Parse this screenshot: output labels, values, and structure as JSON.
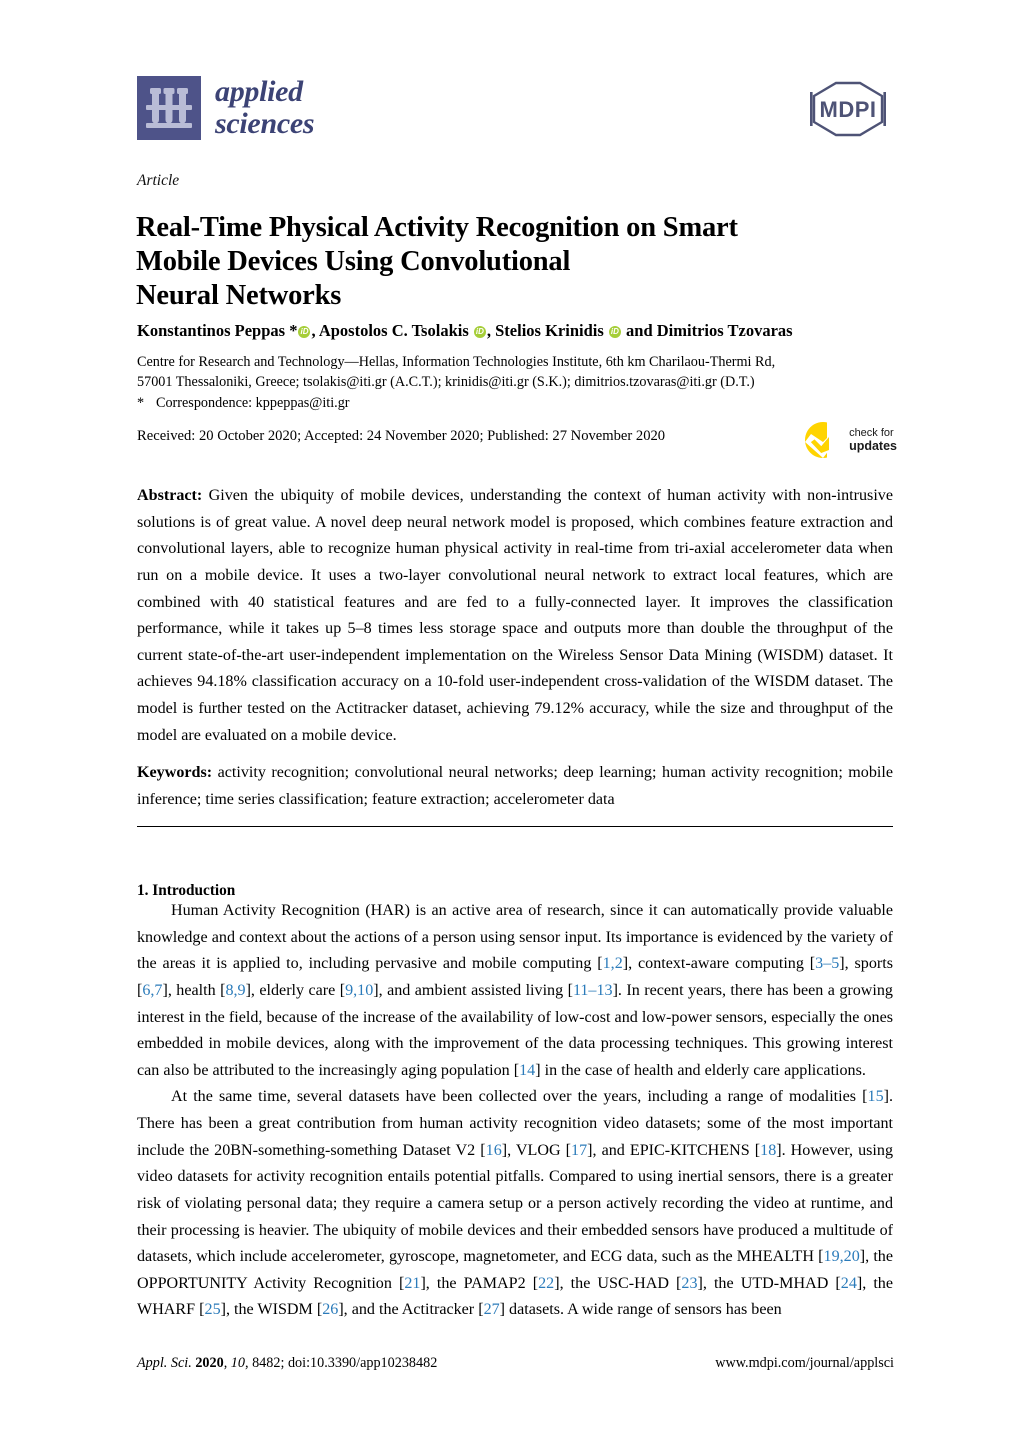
{
  "journal": {
    "name_line1": "applied",
    "name_line2": "sciences",
    "logo_icon": "test-tube-rack-icon",
    "publisher_logo_text": "MDPI"
  },
  "article": {
    "type": "Article",
    "title_line1": "Real-Time Physical Activity Recognition on Smart",
    "title_line2": "Mobile Devices Using Convolutional",
    "title_line3": "Neural Networks"
  },
  "authors": {
    "a1": "Konstantinos Peppas *",
    "orcid_glyph": "iD",
    "sep1": ", ",
    "a2": "Apostolos C. Tsolakis ",
    "sep2": ", ",
    "a3": "Stelios Krinidis ",
    "sep3": " and ",
    "a4": "Dimitrios Tzovaras"
  },
  "affiliation": {
    "line1": "Centre for Research and Technology—Hellas, Information Technologies Institute, 6th km Charilaou-Thermi Rd,",
    "line2": "57001 Thessaloniki, Greece; tsolakis@iti.gr (A.C.T.); krinidis@iti.gr (S.K.); dimitrios.tzovaras@iti.gr (D.T.)",
    "corr_marker": "*",
    "corr_text": "Correspondence: kppeppas@iti.gr"
  },
  "dates": {
    "text": "Received: 20 October 2020; Accepted: 24 November 2020; Published: 27 November 2020"
  },
  "check_for_updates": {
    "line1": "check for",
    "line2": "updates",
    "icon": "yellow-checkmark-icon",
    "color": "#ffd400"
  },
  "abstract": {
    "label": "Abstract:",
    "body": " Given the ubiquity of mobile devices, understanding the context of human activity with non-intrusive solutions is of great value. A novel deep neural network model is proposed, which combines feature extraction and convolutional layers, able to recognize human physical activity in real-time from tri-axial accelerometer data when run on a mobile device. It uses a two-layer convolutional neural network to extract local features, which are combined with 40 statistical features and are fed to a fully-connected layer. It improves the classification performance, while it takes up 5–8 times less storage space and outputs more than double the throughput of the current state-of-the-art user-independent implementation on the Wireless Sensor Data Mining (WISDM) dataset. It achieves 94.18% classification accuracy on a 10-fold user-independent cross-validation of the WISDM dataset. The model is further tested on the Actitracker dataset, achieving 79.12% accuracy, while the size and throughput of the model are evaluated on a mobile device."
  },
  "keywords": {
    "label": "Keywords:",
    "body": " activity recognition; convolutional neural networks; deep learning; human activity recognition; mobile inference; time series classification; feature extraction; accelerometer data"
  },
  "section": {
    "heading": "1. Introduction",
    "para1_a": "Human Activity Recognition (HAR) is an active area of research, since it can automatically provide valuable knowledge and context about the actions of a person using sensor input. Its importance is evidenced by the variety of the areas it is applied to, including pervasive and mobile computing [",
    "c1": "1,2",
    "para1_b": "], context-aware computing [",
    "c2": "3–5",
    "para1_c": "], sports [",
    "c3": "6,7",
    "para1_d": "], health [",
    "c4": "8,9",
    "para1_e": "], elderly care [",
    "c5": "9,10",
    "para1_f": "], and ambient assisted living [",
    "c6": "11–13",
    "para1_g": "]. In recent years, there has been a growing interest in the field, because of the increase of the availability of low-cost and low-power sensors, especially the ones embedded in mobile devices, along with the improvement of the data processing techniques. This growing interest can also be attributed to the increasingly aging population [",
    "c7": "14",
    "para1_h": "] in the case of health and elderly care applications.",
    "para2_a": "At the same time, several datasets have been collected over the years, including a range of modalities [",
    "c8": "15",
    "para2_b": "]. There has been a great contribution from human activity recognition video datasets; some of the most important include the 20BN-something-something Dataset V2 [",
    "c9": "16",
    "para2_c": "], VLOG [",
    "c10": "17",
    "para2_d": "], and EPIC-KITCHENS [",
    "c11": "18",
    "para2_e": "]. However, using video datasets for activity recognition entails potential pitfalls. Compared to using inertial sensors, there is a greater risk of violating personal data; they require a camera setup or a person actively recording the video at runtime, and their processing is heavier. The ubiquity of mobile devices and their embedded sensors have produced a multitude of datasets, which include accelerometer, gyroscope, magnetometer, and ECG data, such as the MHEALTH [",
    "c12": "19,20",
    "para2_f": "], the OPPORTUNITY Activity Recognition [",
    "c13": "21",
    "para2_g": "], the PAMAP2 [",
    "c14": "22",
    "para2_h": "], the USC-HAD [",
    "c15": "23",
    "para2_i": "], the UTD-MHAD [",
    "c16": "24",
    "para2_j": "], the WHARF [",
    "c17": "25",
    "para2_k": "], the WISDM [",
    "c18": "26",
    "para2_l": "], and the Actitracker [",
    "c19": "27",
    "para2_m": "] datasets. A wide range of sensors has been"
  },
  "footer": {
    "journal_abbrev": "Appl. Sci.",
    "year": "2020",
    "volume": "10",
    "article_no": "8482",
    "doi": "doi:10.3390/app10238482",
    "url": "www.mdpi.com/journal/applsci"
  },
  "colors": {
    "brand_blue": "#4e5389",
    "citation_blue": "#2b7bba",
    "orcid_green": "#a6ce39",
    "badge_yellow": "#ffd400"
  }
}
